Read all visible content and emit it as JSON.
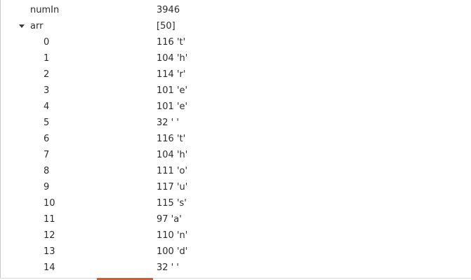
{
  "variables": {
    "numIn": {
      "name": "numIn",
      "value": "3946"
    },
    "arr": {
      "name": "arr",
      "value": "[50]",
      "expanded": true,
      "items": [
        {
          "index": "0",
          "value": "116 't'"
        },
        {
          "index": "1",
          "value": "104 'h'"
        },
        {
          "index": "2",
          "value": "114 'r'"
        },
        {
          "index": "3",
          "value": "101 'e'"
        },
        {
          "index": "4",
          "value": "101 'e'"
        },
        {
          "index": "5",
          "value": "32 ' '"
        },
        {
          "index": "6",
          "value": "116 't'"
        },
        {
          "index": "7",
          "value": "104 'h'"
        },
        {
          "index": "8",
          "value": "111 'o'"
        },
        {
          "index": "9",
          "value": "117 'u'"
        },
        {
          "index": "10",
          "value": "115 's'"
        },
        {
          "index": "11",
          "value": "97 'a'"
        },
        {
          "index": "12",
          "value": "110 'n'"
        },
        {
          "index": "13",
          "value": "100 'd'"
        },
        {
          "index": "14",
          "value": "32 ' '"
        }
      ]
    }
  },
  "colors": {
    "accent": "#e95420",
    "text": "#2b2b2b",
    "border": "#c8c8c8"
  }
}
